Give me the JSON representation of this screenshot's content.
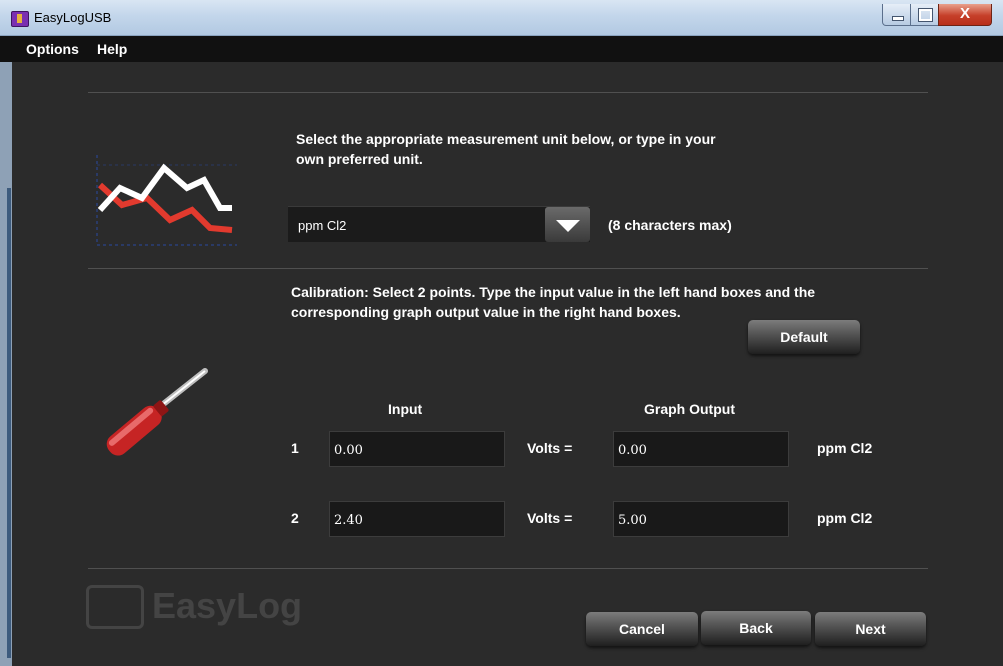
{
  "window": {
    "title": "EasyLogUSB",
    "close_glyph": "X"
  },
  "menu": {
    "items": [
      "Options",
      "Help"
    ]
  },
  "unit_section": {
    "instruction_line1": "Select the appropriate measurement unit below, or type in your",
    "instruction_line2": "own preferred unit.",
    "selected_unit": "ppm Cl2",
    "char_limit_note": "(8 characters max)",
    "icon": "line-chart-icon"
  },
  "calibration": {
    "instruction_line1": "Calibration: Select 2 points. Type the input value in the left hand boxes and the",
    "instruction_line2": "corresponding graph output value in the right hand boxes.",
    "default_button": "Default",
    "icon": "screwdriver-icon",
    "input_header": "Input",
    "output_header": "Graph Output",
    "rows": [
      {
        "index": "1",
        "input": "0.00",
        "mid_label": "Volts =",
        "output": "0.00",
        "unit": "ppm Cl2"
      },
      {
        "index": "2",
        "input": "2.40",
        "mid_label": "Volts =",
        "output": "5.00",
        "unit": "ppm Cl2"
      }
    ]
  },
  "footer": {
    "brand": "EasyLog",
    "cancel": "Cancel",
    "back": "Back",
    "next": "Next"
  },
  "colors": {
    "chart_white": "#ffffff",
    "chart_red": "#e23a2e",
    "screwdriver_red": "#c62424"
  }
}
